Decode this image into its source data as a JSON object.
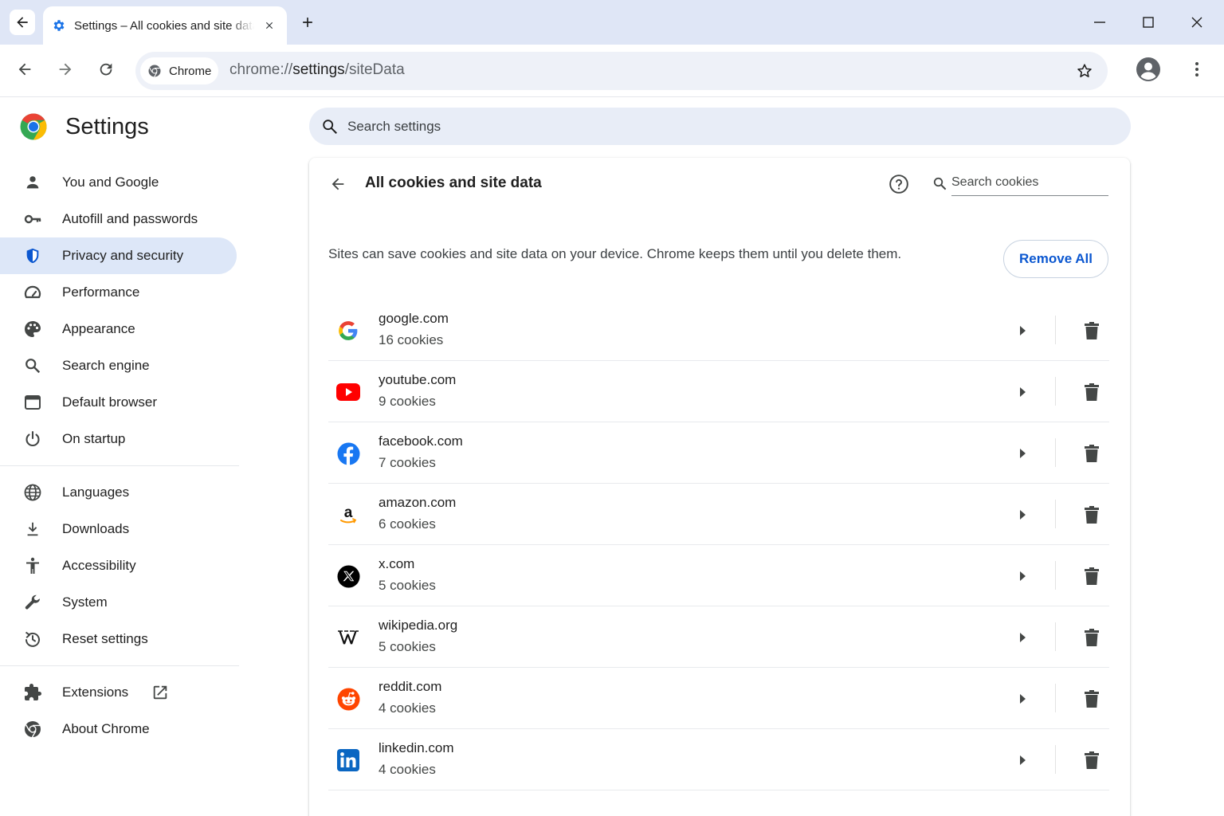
{
  "tab": {
    "title": "Settings – All cookies and site data",
    "icon": "gear-icon"
  },
  "toolbar": {
    "chip_label": "Chrome",
    "url_prefix": "chrome://",
    "url_host": "settings",
    "url_path": "/siteData"
  },
  "sidebar": {
    "title": "Settings",
    "groups": [
      [
        {
          "label": "You and Google",
          "icon": "person-icon"
        },
        {
          "label": "Autofill and passwords",
          "icon": "key-icon"
        },
        {
          "label": "Privacy and security",
          "icon": "shield-icon",
          "active": true
        },
        {
          "label": "Performance",
          "icon": "speedometer-icon"
        },
        {
          "label": "Appearance",
          "icon": "palette-icon"
        },
        {
          "label": "Search engine",
          "icon": "search-icon"
        },
        {
          "label": "Default browser",
          "icon": "browser-window-icon"
        },
        {
          "label": "On startup",
          "icon": "power-icon"
        }
      ],
      [
        {
          "label": "Languages",
          "icon": "globe-icon"
        },
        {
          "label": "Downloads",
          "icon": "download-icon"
        },
        {
          "label": "Accessibility",
          "icon": "accessibility-icon"
        },
        {
          "label": "System",
          "icon": "wrench-icon"
        },
        {
          "label": "Reset settings",
          "icon": "reset-icon"
        }
      ],
      [
        {
          "label": "Extensions",
          "icon": "puzzle-icon",
          "external": true
        },
        {
          "label": "About Chrome",
          "icon": "chrome-icon"
        }
      ]
    ]
  },
  "search": {
    "placeholder": "Search settings"
  },
  "page": {
    "title": "All cookies and site data",
    "search_placeholder": "Search cookies",
    "description": "Sites can save cookies and site data on your device. Chrome keeps them until you delete them.",
    "remove_all_label": "Remove All"
  },
  "sites": [
    {
      "domain": "google.com",
      "cookies": "16 cookies",
      "icon": "google-icon"
    },
    {
      "domain": "youtube.com",
      "cookies": "9 cookies",
      "icon": "youtube-icon"
    },
    {
      "domain": "facebook.com",
      "cookies": "7 cookies",
      "icon": "facebook-icon"
    },
    {
      "domain": "amazon.com",
      "cookies": "6 cookies",
      "icon": "amazon-icon"
    },
    {
      "domain": "x.com",
      "cookies": "5 cookies",
      "icon": "x-icon"
    },
    {
      "domain": "wikipedia.org",
      "cookies": "5 cookies",
      "icon": "wikipedia-icon"
    },
    {
      "domain": "reddit.com",
      "cookies": "4 cookies",
      "icon": "reddit-icon"
    },
    {
      "domain": "linkedin.com",
      "cookies": "4 cookies",
      "icon": "linkedin-icon"
    }
  ],
  "colors": {
    "accent": "#0b57d0",
    "active_nav_bg": "#dde7f8",
    "tabstrip_bg": "#dfe6f6",
    "icon_gray": "#444746"
  }
}
